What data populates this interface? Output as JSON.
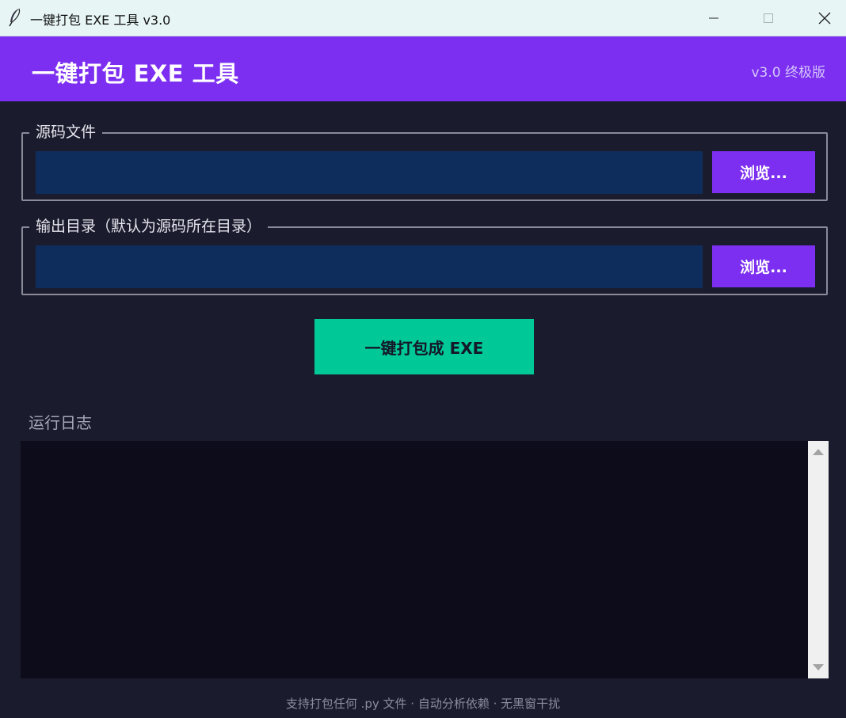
{
  "window": {
    "title": "一键打包 EXE 工具 v3.0",
    "icon": "feather-icon",
    "controls": [
      "minimize-icon",
      "maximize-icon",
      "close-icon"
    ]
  },
  "header": {
    "title": "一键打包 EXE 工具",
    "version": "v3.0 终极版"
  },
  "source": {
    "legend": "源码文件",
    "value": "",
    "browse_label": "浏览..."
  },
  "output": {
    "legend": "输出目录（默认为源码所在目录）",
    "value": "",
    "browse_label": "浏览..."
  },
  "pack_button": "一键打包成 EXE",
  "log": {
    "label": "运行日志",
    "content": ""
  },
  "footer": "支持打包任何 .py 文件 · 自动分析依赖 · 无黑窗干扰",
  "colors": {
    "header": "#7c2ff0",
    "accent_button": "#00c896",
    "background": "#1b1b2e",
    "field": "#0f2d5c",
    "log_background": "#0c0c1a"
  }
}
